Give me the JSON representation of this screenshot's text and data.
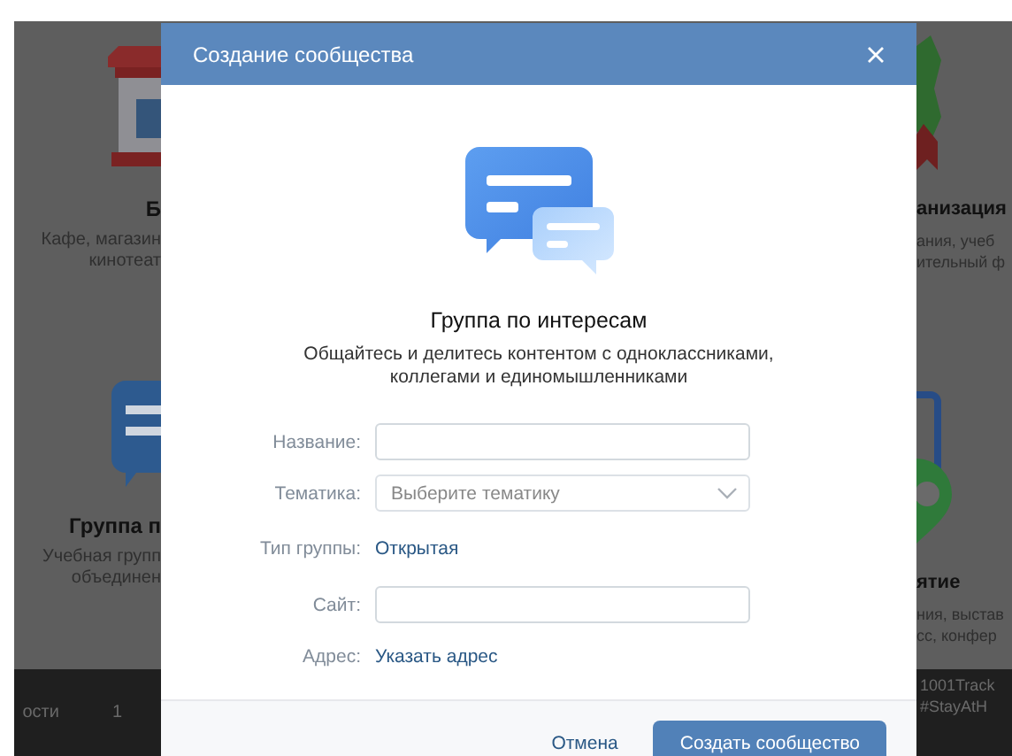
{
  "background": {
    "left_column": {
      "cards": [
        {
          "title": "Б",
          "description_lines": [
            "Кафе, магазин",
            "кинотеат"
          ]
        },
        {
          "title": "Группа п",
          "description_lines": [
            "Учебная групп",
            "объединен"
          ]
        }
      ],
      "bottom_bar": [
        "ости",
        "1"
      ]
    },
    "right_column": {
      "cards": [
        {
          "title": "анизация",
          "description_lines": [
            "ания, учеб",
            "ительный ф"
          ]
        },
        {
          "title": "ятие",
          "description_lines": [
            "ния, выстав",
            "сс, конфер"
          ]
        }
      ],
      "bottom_bar": [
        "1001Track",
        "#StayAtH"
      ]
    }
  },
  "dialog": {
    "title": "Создание сообщества",
    "heading": "Группа по интересам",
    "description_lines": [
      "Общайтесь и делитесь контентом с одноклассниками,",
      "коллегами и единомышленниками"
    ],
    "fields": [
      {
        "kind": "text",
        "label": "Название:"
      },
      {
        "kind": "select",
        "label": "Тематика:",
        "placeholder": "Выберите тематику"
      },
      {
        "kind": "link",
        "label": "Тип группы:",
        "value": "Открытая"
      },
      {
        "kind": "text",
        "label": "Сайт:"
      },
      {
        "kind": "link",
        "label": "Адрес:",
        "value": "Указать адрес"
      }
    ],
    "buttons": [
      {
        "kind": "secondary",
        "label": "Отмена"
      },
      {
        "kind": "primary",
        "label": "Создать сообщество"
      }
    ]
  }
}
